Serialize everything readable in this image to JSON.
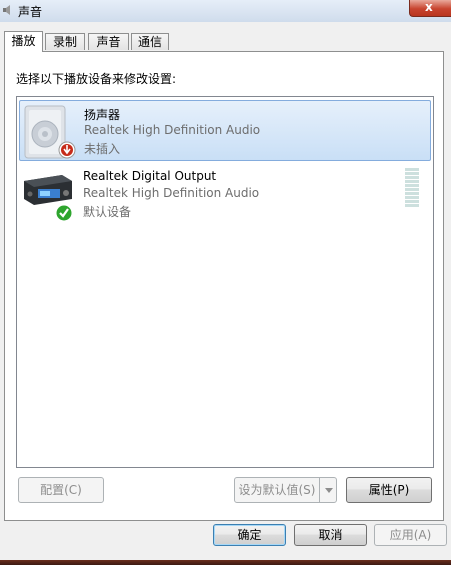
{
  "window": {
    "title": "声音",
    "close_glyph": "x"
  },
  "tabs": [
    {
      "label": "播放",
      "active": true
    },
    {
      "label": "录制",
      "active": false
    },
    {
      "label": "声音",
      "active": false
    },
    {
      "label": "通信",
      "active": false
    }
  ],
  "instruction": "选择以下播放设备来修改设置:",
  "devices": [
    {
      "name": "扬声器",
      "driver": "Realtek High Definition Audio",
      "status": "未插入",
      "icon": "speaker-icon",
      "badge": "unplugged-badge-icon",
      "selected": true
    },
    {
      "name": "Realtek Digital Output",
      "driver": "Realtek High Definition Audio",
      "status": "默认设备",
      "icon": "digital-output-icon",
      "badge": "default-check-icon",
      "selected": false
    }
  ],
  "panel_buttons": {
    "configure": "配置(C)",
    "set_default": "设为默认值(S)",
    "properties": "属性(P)"
  },
  "dialog_buttons": {
    "ok": "确定",
    "cancel": "取消",
    "apply": "应用(A)"
  },
  "colors": {
    "selection": "#c9dff6",
    "check_green": "#2ea52e",
    "unplugged_red": "#c62b1a",
    "close_red": "#c8442f"
  }
}
